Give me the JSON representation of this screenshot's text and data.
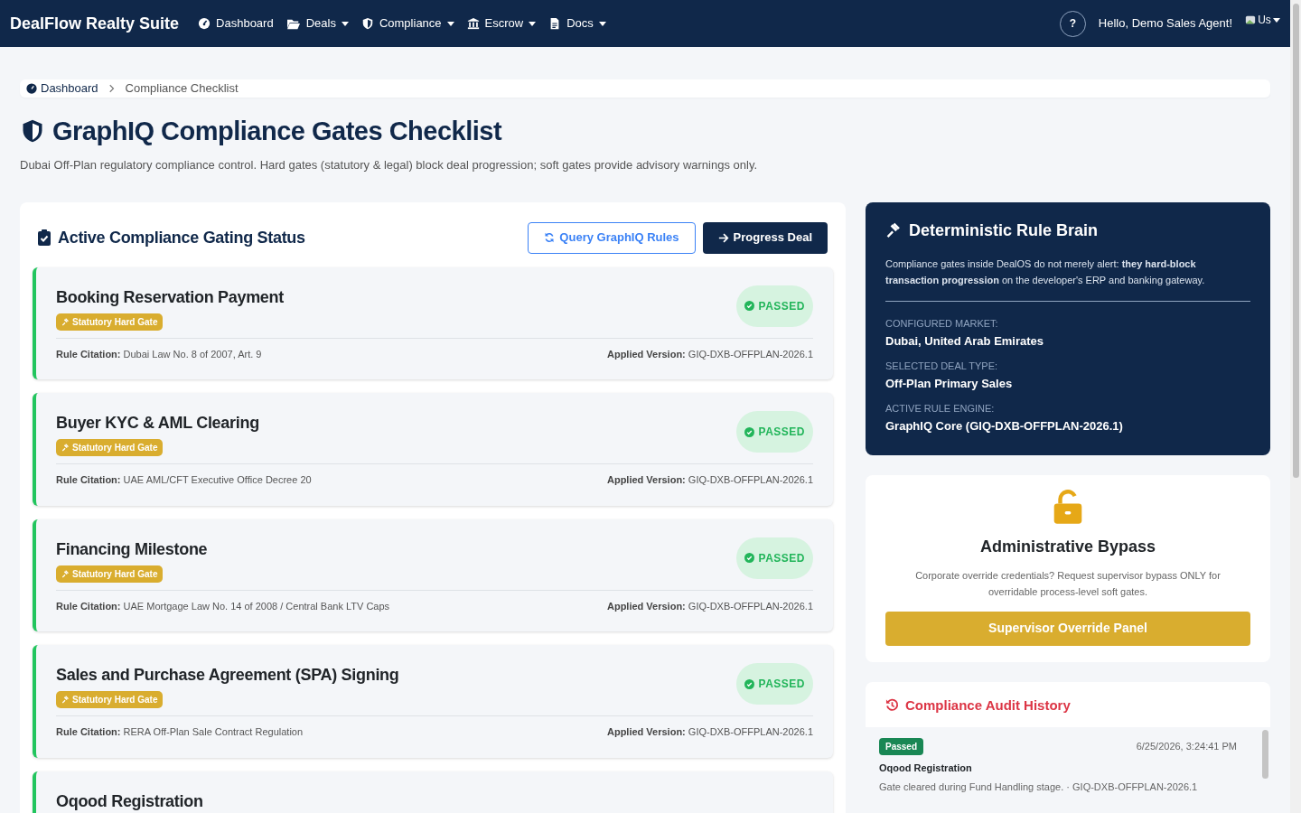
{
  "navbar": {
    "brand": "DealFlow Realty Suite",
    "items": [
      {
        "label": "Dashboard",
        "dropdown": false
      },
      {
        "label": "Deals",
        "dropdown": true
      },
      {
        "label": "Compliance",
        "dropdown": true
      },
      {
        "label": "Escrow",
        "dropdown": true
      },
      {
        "label": "Docs",
        "dropdown": true
      }
    ],
    "help": "?",
    "greeting": "Hello, Demo Sales Agent!",
    "avatar_alt": "Us"
  },
  "breadcrumb": [
    {
      "label": "Dashboard",
      "link": true
    },
    {
      "label": "Compliance Checklist",
      "link": false
    }
  ],
  "page": {
    "title": "GraphIQ Compliance Gates Checklist",
    "subtitle": "Dubai Off-Plan regulatory compliance control. Hard gates (statutory & legal) block deal progression; soft gates provide advisory warnings only."
  },
  "status_panel": {
    "title": "Active Compliance Gating Status",
    "buttons": [
      {
        "label": "Query GraphIQ Rules",
        "kind": "outline"
      },
      {
        "label": "Progress Deal",
        "kind": "solid"
      }
    ],
    "gates": [
      {
        "title": "Booking Reservation Payment",
        "badge": "Statutory Hard Gate",
        "citation_label": "Rule Citation:",
        "citation": "Dubai Law No. 8 of 2007, Art. 9",
        "version_label": "Applied Version:",
        "version": "GIQ-DXB-OFFPLAN-2026.1",
        "status": "PASSED",
        "passed": true
      },
      {
        "title": "Buyer KYC & AML Clearing",
        "badge": "Statutory Hard Gate",
        "citation_label": "Rule Citation:",
        "citation": "UAE AML/CFT Executive Office Decree 20",
        "version_label": "Applied Version:",
        "version": "GIQ-DXB-OFFPLAN-2026.1",
        "status": "PASSED",
        "passed": true
      },
      {
        "title": "Financing Milestone",
        "badge": "Statutory Hard Gate",
        "citation_label": "Rule Citation:",
        "citation": "UAE Mortgage Law No. 14 of 2008 / Central Bank LTV Caps",
        "version_label": "Applied Version:",
        "version": "GIQ-DXB-OFFPLAN-2026.1",
        "status": "PASSED",
        "passed": true
      },
      {
        "title": "Sales and Purchase Agreement (SPA) Signing",
        "badge": "Statutory Hard Gate",
        "citation_label": "Rule Citation:",
        "citation": "RERA Off-Plan Sale Contract Regulation",
        "version_label": "Applied Version:",
        "version": "GIQ-DXB-OFFPLAN-2026.1",
        "status": "PASSED",
        "passed": true
      },
      {
        "title": "Oqood Registration",
        "passed": true
      }
    ]
  },
  "rule_brain": {
    "title": "Deterministic Rule Brain",
    "description": "Compliance gates inside DealOS do not merely alert: **they hard-block transaction progression** on the developer's ERP and banking gateway.",
    "fields": [
      {
        "label": "CONFIGURED MARKET:",
        "value": "Dubai, United Arab Emirates"
      },
      {
        "label": "SELECTED DEAL TYPE:",
        "value": "Off-Plan Primary Sales"
      },
      {
        "label": "ACTIVE RULE ENGINE:",
        "value": "GraphIQ Core (GIQ-DXB-OFFPLAN-2026.1)"
      }
    ]
  },
  "bypass": {
    "title": "Administrative Bypass",
    "description": "Corporate override credentials? Request supervisor bypass ONLY for overridable process-level soft gates.",
    "button": "Supervisor Override Panel"
  },
  "audit": {
    "title": "Compliance Audit History",
    "entries": [
      {
        "status": "Passed",
        "passed": true,
        "time": "6/25/2026, 3:24:41 PM",
        "gate": "Oqood Registration",
        "detail": "Gate cleared during Fund Handling stage. · GIQ-DXB-OFFPLAN-2026.1"
      }
    ]
  }
}
